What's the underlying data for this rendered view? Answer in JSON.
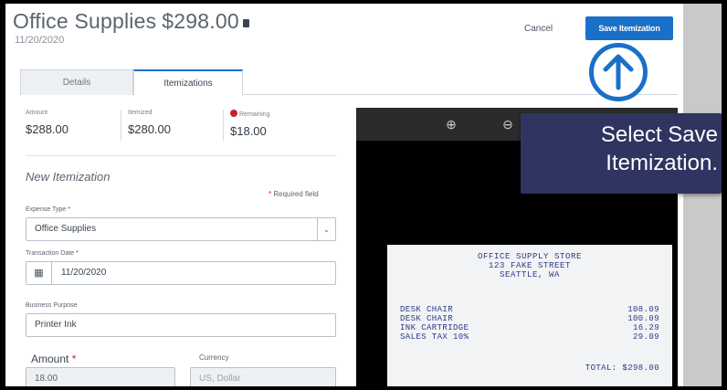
{
  "header": {
    "title": "Office Supplies",
    "amount": "$298.00",
    "date": "11/20/2020",
    "cancel_label": "Cancel",
    "save_label": "Save Itemization"
  },
  "tabs": [
    {
      "label": "Details",
      "active": false
    },
    {
      "label": "Itemizations",
      "active": true
    }
  ],
  "summary": {
    "amount_label": "Amount",
    "amount_value": "$288.00",
    "itemized_label": "Itemized",
    "itemized_value": "$280.00",
    "remaining_label": "Remaining",
    "remaining_value": "$18.00"
  },
  "form": {
    "section_title": "New Itemization",
    "required_note": "Required field",
    "expense_type_label": "Expense Type",
    "expense_type_value": "Office Supplies",
    "transaction_date_label": "Transaction Date",
    "transaction_date_value": "11/20/2020",
    "business_purpose_label": "Business Purpose",
    "business_purpose_value": "Printer Ink",
    "amount_label": "Amount",
    "amount_value": "18.00",
    "currency_label": "Currency",
    "currency_value": "US, Dollar"
  },
  "receipt": {
    "store": "OFFICE SUPPLY STORE",
    "street": "123 FAKE STREET",
    "city": "SEATTLE, WA",
    "items": [
      {
        "name": "DESK CHAIR",
        "price": "108.09"
      },
      {
        "name": "DESK CHAIR",
        "price": "100.09"
      },
      {
        "name": "INK CARTRIDGE",
        "price": "16.29"
      },
      {
        "name": "SALES TAX 10%",
        "price": "29.09"
      }
    ],
    "total": "TOTAL:  $298.00"
  },
  "callout": {
    "line1": "Select Save",
    "line2": "Itemization."
  },
  "colors": {
    "accent": "#1a6fc9",
    "callout_bg": "#2f3560",
    "alert": "#c8202b"
  }
}
